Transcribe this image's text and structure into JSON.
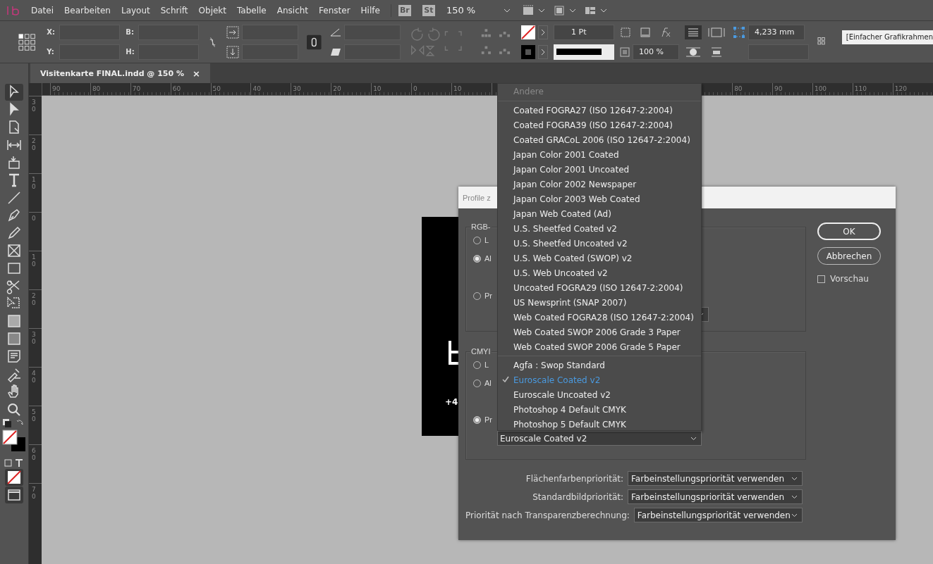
{
  "menu_bar": {
    "items": [
      "Datei",
      "Bearbeiten",
      "Layout",
      "Schrift",
      "Objekt",
      "Tabelle",
      "Ansicht",
      "Fenster",
      "Hilfe"
    ],
    "bridge": "Br",
    "stock": "St",
    "zoom": "150 %"
  },
  "control_bar": {
    "x_label": "X:",
    "y_label": "Y:",
    "w_label": "B:",
    "h_label": "H:",
    "stroke_weight": "1 Pt",
    "opacity": "100 %",
    "corner_size": "4,233 mm",
    "frame_style": "[Einfacher Grafikrahmen"
  },
  "document_tab": {
    "title": "Visitenkarte FINAL.indd @ 150 %",
    "close": "×"
  },
  "ruler": {
    "left_labels": [
      "90",
      "80",
      "70",
      "60",
      "50",
      "40",
      "30",
      "20",
      "10",
      "0",
      "10"
    ],
    "right_labels": [
      "80",
      "90",
      "100",
      "110",
      "120"
    ],
    "vertical_labels": [
      "30",
      "20",
      "10",
      "0",
      "10",
      "20",
      "30",
      "40",
      "50",
      "60",
      "70"
    ]
  },
  "card": {
    "phone": "+4"
  },
  "dialog": {
    "title": "Profile z",
    "sections": [
      {
        "legend": "RGB-",
        "options": [
          {
            "label": "L",
            "selected": false
          },
          {
            "label": "Al",
            "selected": true
          },
          {
            "label": "Pr",
            "selected": false
          }
        ]
      },
      {
        "legend": "CMYI",
        "options": [
          {
            "label": "L",
            "selected": false
          },
          {
            "label": "Al",
            "selected": false
          },
          {
            "label": "Pr",
            "selected": true
          }
        ],
        "select_value": "Euroscale Coated v2"
      }
    ],
    "buttons": [
      {
        "label": "OK",
        "default": true
      },
      {
        "label": "Abbrechen",
        "default": false
      }
    ],
    "preview": {
      "label": "Vorschau",
      "checked": false
    },
    "priorities": [
      {
        "label": "Flächenfarbenpriorität:",
        "value": "Farbeinstellungspriorität verwenden"
      },
      {
        "label": "Standardbildpriorität:",
        "value": "Farbeinstellungspriorität verwenden"
      },
      {
        "label": "Priorität nach Transparenzberechnung:",
        "value": "Farbeinstellungspriorität verwenden"
      }
    ]
  },
  "dropdown": {
    "header": "Andere",
    "groups": [
      [
        {
          "label": "Coated FOGRA27 (ISO 12647-2:2004)",
          "selected": false
        },
        {
          "label": "Coated FOGRA39 (ISO 12647-2:2004)",
          "selected": false
        },
        {
          "label": "Coated GRACoL 2006 (ISO 12647-2:2004)",
          "selected": false
        },
        {
          "label": "Japan Color 2001 Coated",
          "selected": false
        },
        {
          "label": "Japan Color 2001 Uncoated",
          "selected": false
        },
        {
          "label": "Japan Color 2002 Newspaper",
          "selected": false
        },
        {
          "label": "Japan Color 2003 Web Coated",
          "selected": false
        },
        {
          "label": "Japan Web Coated (Ad)",
          "selected": false
        },
        {
          "label": "U.S. Sheetfed Coated v2",
          "selected": false
        },
        {
          "label": "U.S. Sheetfed Uncoated v2",
          "selected": false
        },
        {
          "label": "U.S. Web Coated (SWOP) v2",
          "selected": false
        },
        {
          "label": "U.S. Web Uncoated v2",
          "selected": false
        },
        {
          "label": "Uncoated FOGRA29 (ISO 12647-2:2004)",
          "selected": false
        },
        {
          "label": "US Newsprint (SNAP 2007)",
          "selected": false
        },
        {
          "label": "Web Coated FOGRA28 (ISO 12647-2:2004)",
          "selected": false
        },
        {
          "label": "Web Coated SWOP 2006 Grade 3 Paper",
          "selected": false
        },
        {
          "label": "Web Coated SWOP 2006 Grade 5 Paper",
          "selected": false
        }
      ],
      [
        {
          "label": "Agfa : Swop Standard",
          "selected": false
        },
        {
          "label": "Euroscale Coated v2",
          "selected": true
        },
        {
          "label": "Euroscale Uncoated v2",
          "selected": false
        },
        {
          "label": "Photoshop 4 Default CMYK",
          "selected": false
        },
        {
          "label": "Photoshop 5 Default CMYK",
          "selected": false
        }
      ]
    ]
  }
}
